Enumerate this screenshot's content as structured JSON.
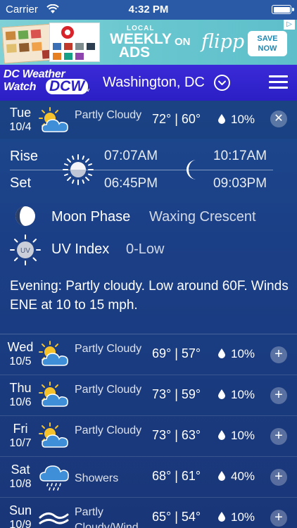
{
  "status_bar": {
    "carrier": "Carrier",
    "time": "4:32 PM"
  },
  "ad": {
    "local": "LOCAL",
    "weekly": "WEEKLY",
    "ads": "ADS",
    "on": "ON",
    "brand": "flipp",
    "save": "SAVE",
    "now": "NOW"
  },
  "header": {
    "brand_line1": "DC Weather",
    "brand_line2": "Watch",
    "brand_mark": "DCW",
    "brand_tv": ".tv",
    "location": "Washington, DC"
  },
  "today": {
    "day": "Tue",
    "date": "10/4",
    "condition": "Partly Cloudy",
    "temps": "72° | 60°",
    "precip": "10%",
    "icon": "partly-cloudy-icon"
  },
  "detail": {
    "rise_label": "Rise",
    "set_label": "Set",
    "sunrise": "07:07AM",
    "sunset": "06:45PM",
    "moonrise": "10:17AM",
    "moonset": "09:03PM",
    "moon_phase_label": "Moon Phase",
    "moon_phase_value": "Waxing Crescent",
    "uv_label": "UV Index",
    "uv_value": "0-Low",
    "uv_badge": "UV",
    "forecast": "Evening: Partly cloudy. Low around 60F. Winds ENE at 10 to 15 mph."
  },
  "days": [
    {
      "day": "Wed",
      "date": "10/5",
      "condition": "Partly Cloudy",
      "temps": "69° | 57°",
      "precip": "10%",
      "icon": "partly-cloudy-icon"
    },
    {
      "day": "Thu",
      "date": "10/6",
      "condition": "Partly Cloudy",
      "temps": "73° | 59°",
      "precip": "10%",
      "icon": "partly-cloudy-icon"
    },
    {
      "day": "Fri",
      "date": "10/7",
      "condition": "Partly Cloudy",
      "temps": "73° | 63°",
      "precip": "10%",
      "icon": "partly-cloudy-icon"
    },
    {
      "day": "Sat",
      "date": "10/8",
      "condition": "Showers",
      "temps": "68° | 61°",
      "precip": "40%",
      "icon": "showers-icon"
    },
    {
      "day": "Sun",
      "date": "10/9",
      "condition": "Partly Cloudy/Wind",
      "temps": "65° | 54°",
      "precip": "10%",
      "icon": "wind-icon"
    }
  ],
  "colors": {
    "background": "#1b3f86",
    "header": "#2b1fc4",
    "status_bar": "#2a5aa6",
    "ad_background": "#68c6cf",
    "sun_yellow": "#f6c22c"
  }
}
